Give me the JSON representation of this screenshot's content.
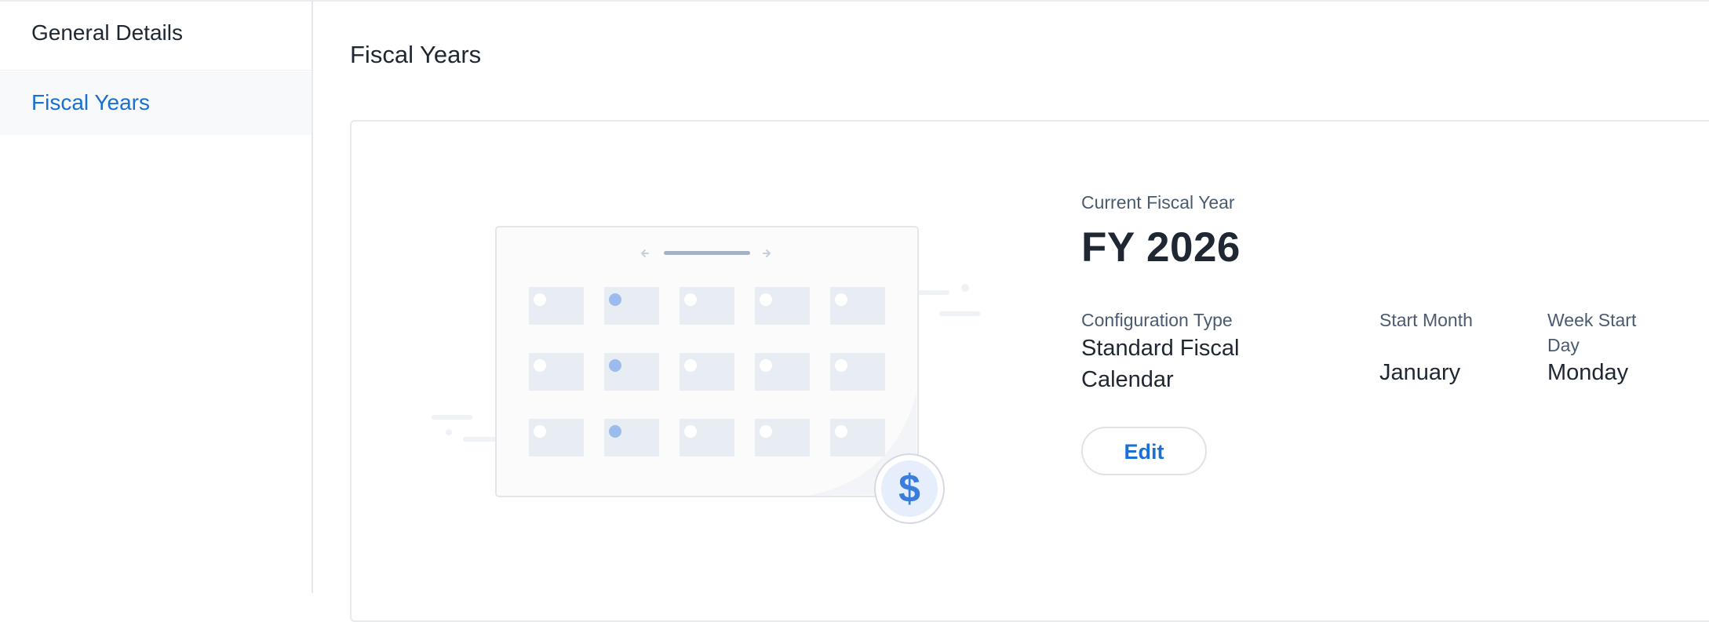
{
  "sidebar": {
    "items": [
      {
        "label": "General Details",
        "active": false
      },
      {
        "label": "Fiscal Years",
        "active": true
      }
    ]
  },
  "main": {
    "title": "Fiscal Years",
    "card": {
      "current_label": "Current Fiscal Year",
      "current_value": "FY 2026",
      "config_type_label": "Configuration Type",
      "config_type_value": "Standard Fiscal Calendar",
      "start_month_label": "Start Month",
      "start_month_value": "January",
      "week_start_label": "Week Start Day",
      "week_start_value": "Monday",
      "edit_label": "Edit"
    },
    "illustration": {
      "icon": "calendar-illustration",
      "badge_icon": "dollar-icon",
      "badge_symbol": "$"
    }
  },
  "colors": {
    "accent": "#1a6fd3",
    "text": "#1f2733",
    "muted_label": "#4a5b70",
    "border": "#e5e8ec",
    "active_bg": "#f7f9fb",
    "illustration_dot": "#9cbcf0"
  }
}
